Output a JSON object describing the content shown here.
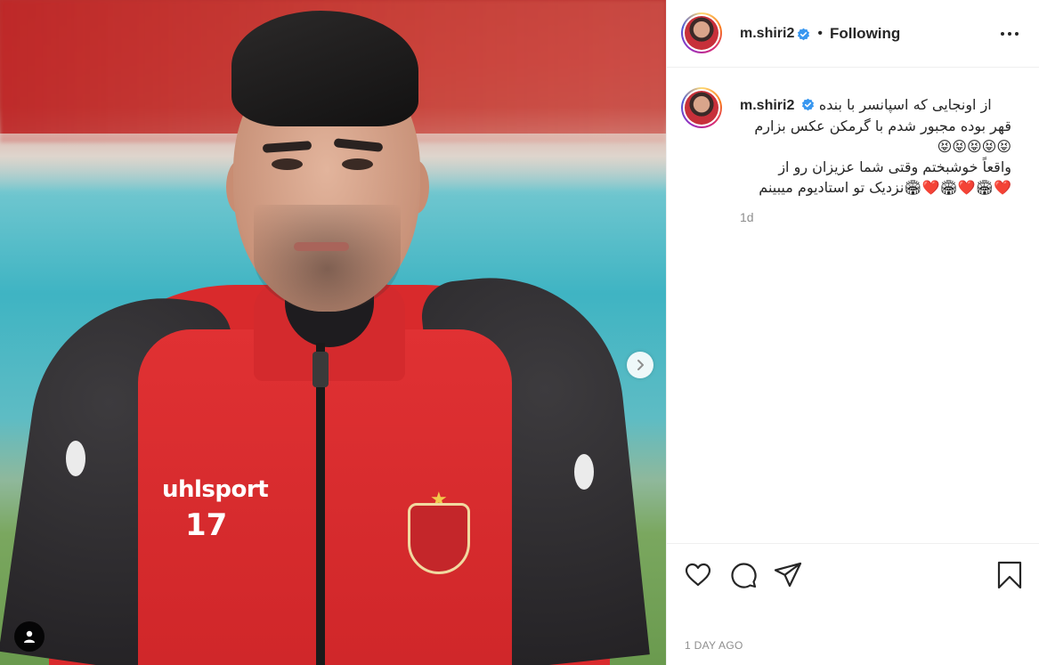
{
  "post": {
    "username": "m.shiri2",
    "follow_status": "Following",
    "separator": "•",
    "verified": true,
    "caption_lines": [
      "از اونجایی که اسپانسر با بنده",
      "قهر بوده مجبور شدم با گرمکن عکس بزارم",
      "😝😝😝😝😝",
      "واقعاً خوشبختم وقتی شما عزیزان رو از",
      "❤️🏟❤️🏟❤️🏟نزدیک تو استادیوم میبینم"
    ],
    "caption_age": "1d",
    "posted_ago": "1 DAY AGO"
  },
  "media": {
    "jersey_brand": "uhlsport",
    "jersey_number": "17"
  },
  "icons": {
    "verified": "verified-badge-icon",
    "more": "more-options-icon",
    "next": "chevron-right-icon",
    "tags": "user-tag-icon",
    "like": "heart-icon",
    "comment": "comment-icon",
    "share": "send-icon",
    "save": "bookmark-icon"
  },
  "colors": {
    "verified_blue": "#3897f0",
    "text": "#262626",
    "muted": "#8e8e8e"
  }
}
